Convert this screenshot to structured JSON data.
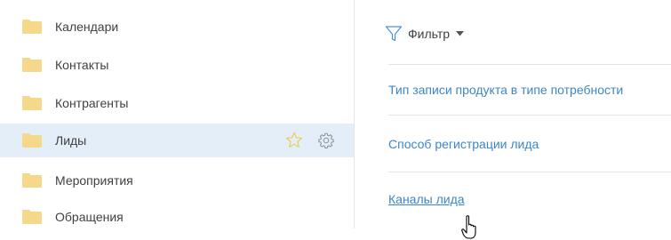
{
  "sidebar": {
    "items": [
      {
        "label": "Календари"
      },
      {
        "label": "Контакты"
      },
      {
        "label": "Контрагенты"
      },
      {
        "label": "Лиды",
        "selected": true
      },
      {
        "label": "Мероприятия"
      },
      {
        "label": "Обращения"
      }
    ]
  },
  "content": {
    "filter_label": "Фильтр",
    "links": [
      {
        "label": "Тип записи продукта в типе потребности"
      },
      {
        "label": "Способ регистрации лида"
      },
      {
        "label": "Каналы лида",
        "hovered": true
      }
    ]
  },
  "colors": {
    "folder": "#f6d88a",
    "selected_bg": "#e3eef9",
    "link": "#3d86c5",
    "star": "#f2c94c"
  },
  "icons": {
    "folder": "folder-icon",
    "star": "star-icon",
    "gear": "gear-icon",
    "filter": "filter-icon",
    "caret": "caret-down-icon",
    "cursor": "hand-pointer-icon"
  }
}
